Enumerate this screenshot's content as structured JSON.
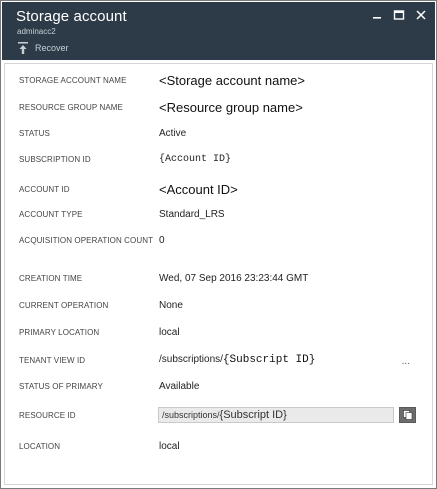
{
  "window": {
    "title": "Storage account",
    "subtitle": "adminacc2",
    "toolbar": {
      "recover_label": "Recover"
    },
    "controls": [
      "minimize-icon",
      "maximize-icon",
      "close-icon"
    ]
  },
  "properties": [
    {
      "label": "STORAGE ACCOUNT NAME",
      "value": "<Storage account name>"
    },
    {
      "label": "RESOURCE GROUP NAME",
      "value": "<Resource group name>"
    },
    {
      "label": "STATUS",
      "value": "Active"
    },
    {
      "label": "SUBSCRIPTION ID",
      "value": "{Account ID}"
    },
    {
      "label": "ACCOUNT ID",
      "value": "<Account ID>"
    },
    {
      "label": "ACCOUNT TYPE",
      "value": "Standard_LRS"
    },
    {
      "label": "ACQUISITION OPERATION COUNT",
      "value": "0"
    },
    {
      "label": "CREATION TIME",
      "value": "Wed, 07 Sep 2016 23:23:44 GMT"
    },
    {
      "label": "CURRENT OPERATION",
      "value": "None"
    },
    {
      "label": "PRIMARY LOCATION",
      "value": "local"
    },
    {
      "label": "TENANT VIEW ID",
      "value_prefix": "/subscriptions/",
      "value_id": "{Subscript ID}",
      "overflow": "..."
    },
    {
      "label": "STATUS OF PRIMARY",
      "value": "Available"
    },
    {
      "label": "RESOURCE ID",
      "value_prefix": "/subscriptions/",
      "value_id": "{Subscript ID}"
    },
    {
      "label": "LOCATION",
      "value": "local"
    }
  ]
}
